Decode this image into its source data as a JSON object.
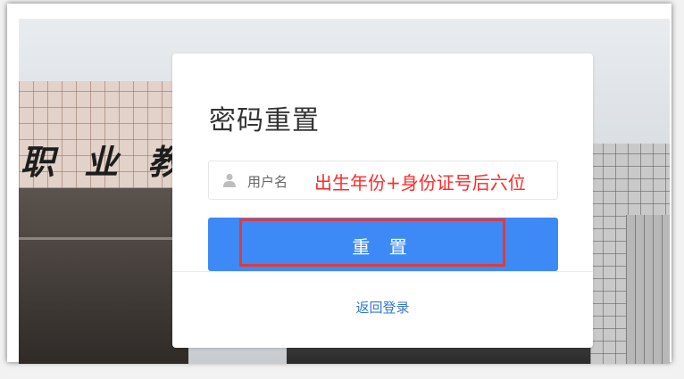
{
  "background": {
    "sign_text": "职 业 教"
  },
  "card": {
    "title": "密码重置",
    "username_field": {
      "icon": "user-icon",
      "label": "用户名",
      "value": "出生年份+身份证号后六位"
    },
    "reset_button": {
      "label": "重 置"
    },
    "back_link": "返回登录"
  },
  "colors": {
    "accent": "#3d8af7",
    "hint_red": "#ff2a2a",
    "highlight_red": "#e23a3a",
    "link": "#3478c6"
  }
}
